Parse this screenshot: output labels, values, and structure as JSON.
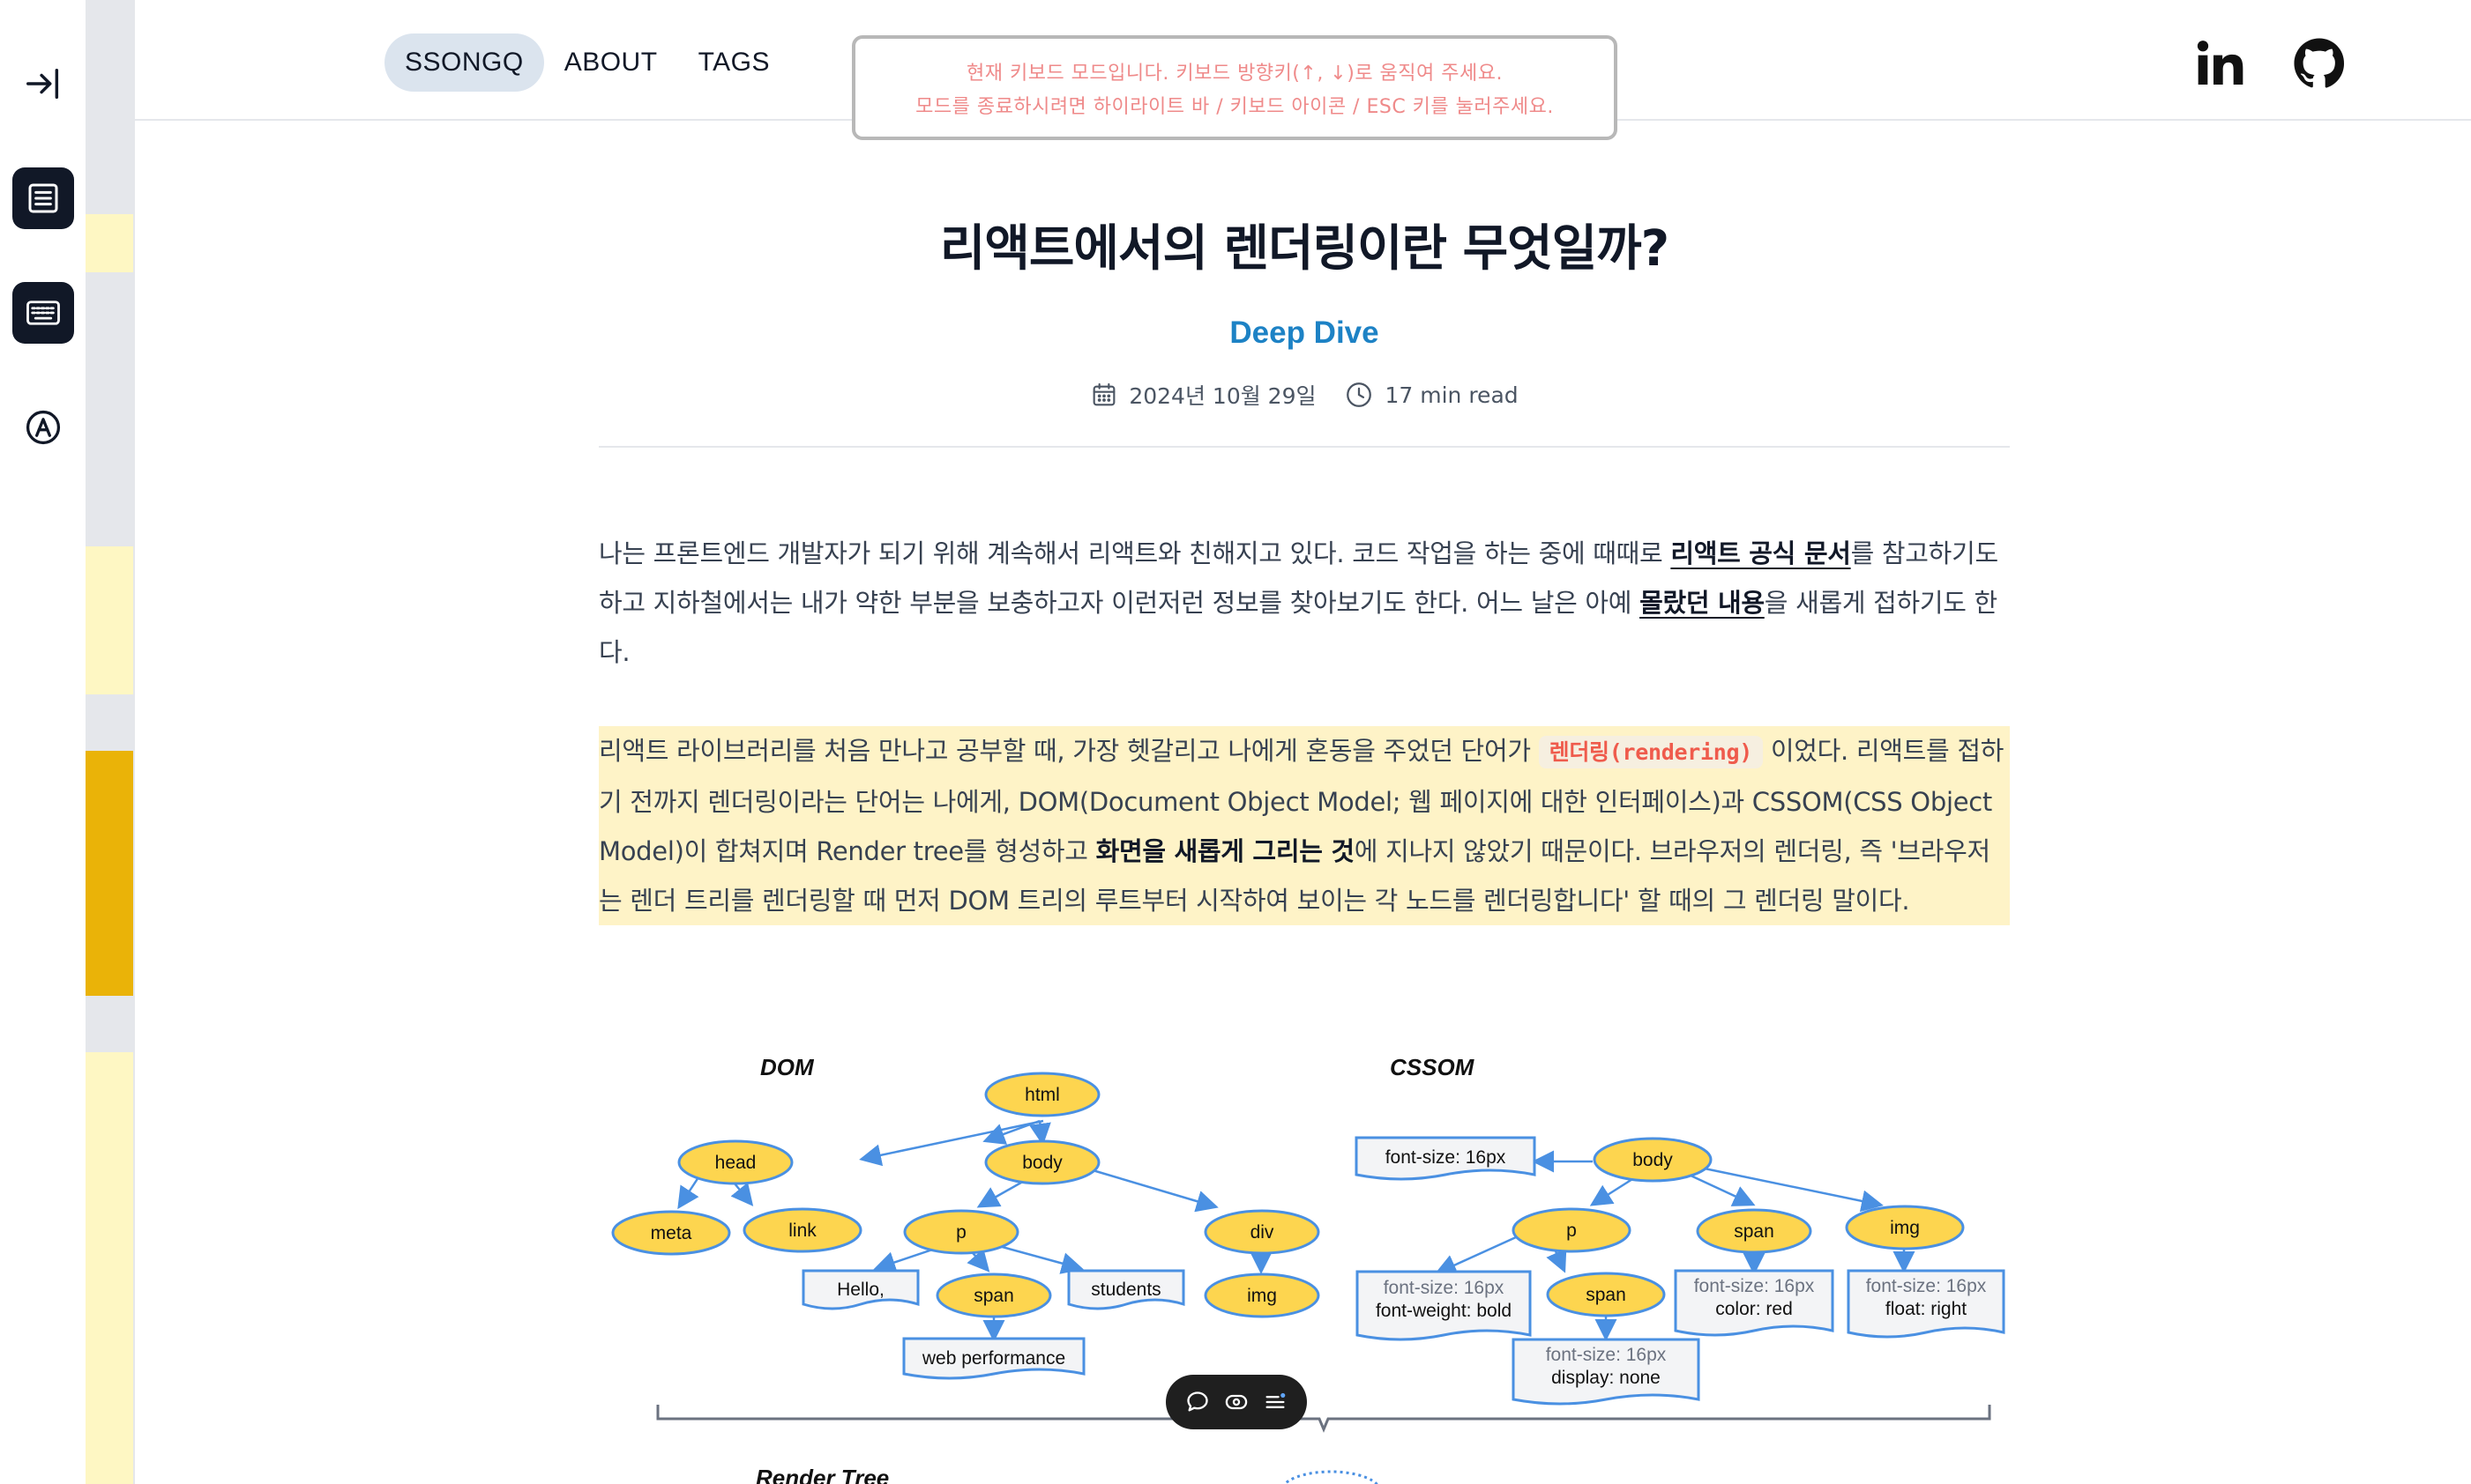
{
  "rail": {
    "items": [
      {
        "name": "collapse-sidebar-button",
        "icon": "arrow-right-to-bar-icon"
      },
      {
        "name": "highlight-list-button",
        "icon": "document-list-icon"
      },
      {
        "name": "keyboard-mode-button",
        "icon": "keyboard-icon"
      },
      {
        "name": "account-button",
        "icon": "circle-a-icon"
      }
    ]
  },
  "minimap": {
    "base_color": "#e5e7eb",
    "highlight_color": "#fef7c3",
    "active_color": "#eab308"
  },
  "header": {
    "nav": [
      {
        "label": "SSONGQ",
        "active": true
      },
      {
        "label": "ABOUT",
        "active": false
      },
      {
        "label": "TAGS",
        "active": false
      }
    ],
    "keyboard_notice": {
      "line1": "현재 키보드 모드입니다. 키보드 방향키(↑, ↓)로 움직여 주세요.",
      "line2": "모드를 종료하시려면 하이라이트 바 / 키보드 아이콘 / ESC 키를 눌러주세요."
    },
    "social": [
      {
        "name": "linkedin",
        "icon": "linkedin-icon"
      },
      {
        "name": "github",
        "icon": "github-icon"
      }
    ]
  },
  "post": {
    "title": "리액트에서의 렌더링이란 무엇일까?",
    "category": "Deep Dive",
    "date": "2024년 10월 29일",
    "read_time": "17 min read",
    "p1": {
      "t1": "나는 프론트엔드 개발자가 되기 위해 계속해서 리액트와 친해지고 있다. 코드 작업을 하는 중에 때때로 ",
      "link1": "리액트 공식 문서",
      "t2": "를 참고하기도 하고 지하철에서는 내가 약한 부분을 보충하고자 이런저런 정보를 찾아보기도 한다. 어느 날은 아예 ",
      "link2": "몰랐던 내용",
      "t3": "을 새롭게 접하기도 한다."
    },
    "p2": {
      "t1": "리액트 라이브러리를 처음 만나고 공부할 때, 가장 헷갈리고 나에게 혼동을 주었던 단어가 ",
      "code": "렌더링(rendering)",
      "t2": " 이었다. 리액트를 접하기 전까지 렌더링이라는 단어는 나에게, DOM(Document Object Model; 웹 페이지에 대한 인터페이스)과 CSSOM(CSS Object Model)이 합쳐지며 Render tree를 형성하고 ",
      "bold": "화면을 새롭게 그리는 것",
      "t3": "에 지나지 않았기 때문이다. 브라우저의 렌더링, 즉 '브라우저는 렌더 트리를 렌더링할 때 먼저 DOM 트리의 루트부터 시작하여 보이는 각 노드를 렌더링합니다' 할 때의 그 렌더링 말이다."
    }
  },
  "diagram": {
    "dom_title": "DOM",
    "cssom_title": "CSSOM",
    "render_title": "Render Tree",
    "node_fill": "#fdd54f",
    "node_stroke": "#4a90e2",
    "box_fill": "#f3f4f6",
    "dom": {
      "html": "html",
      "head": "head",
      "body": "body",
      "meta": "meta",
      "link": "link",
      "p": "p",
      "div": "div",
      "hello": "Hello,",
      "span": "span",
      "students": "students",
      "img": "img",
      "webperf": "web performance"
    },
    "cssom": {
      "root_style": "font-size: 16px",
      "body": "body",
      "p": "p",
      "span": "span",
      "img": "img",
      "span2": "span",
      "p_style1": "font-size: 16px",
      "p_style2": "font-weight: bold",
      "span_style1": "font-size: 16px",
      "span_style2": "color: red",
      "img_style1": "font-size: 16px",
      "img_style2": "float: right",
      "span2_style1": "font-size: 16px",
      "span2_style2": "display: none"
    }
  },
  "floating_toolbar": {
    "items": [
      "comment-icon",
      "eye-icon",
      "list-icon"
    ]
  }
}
